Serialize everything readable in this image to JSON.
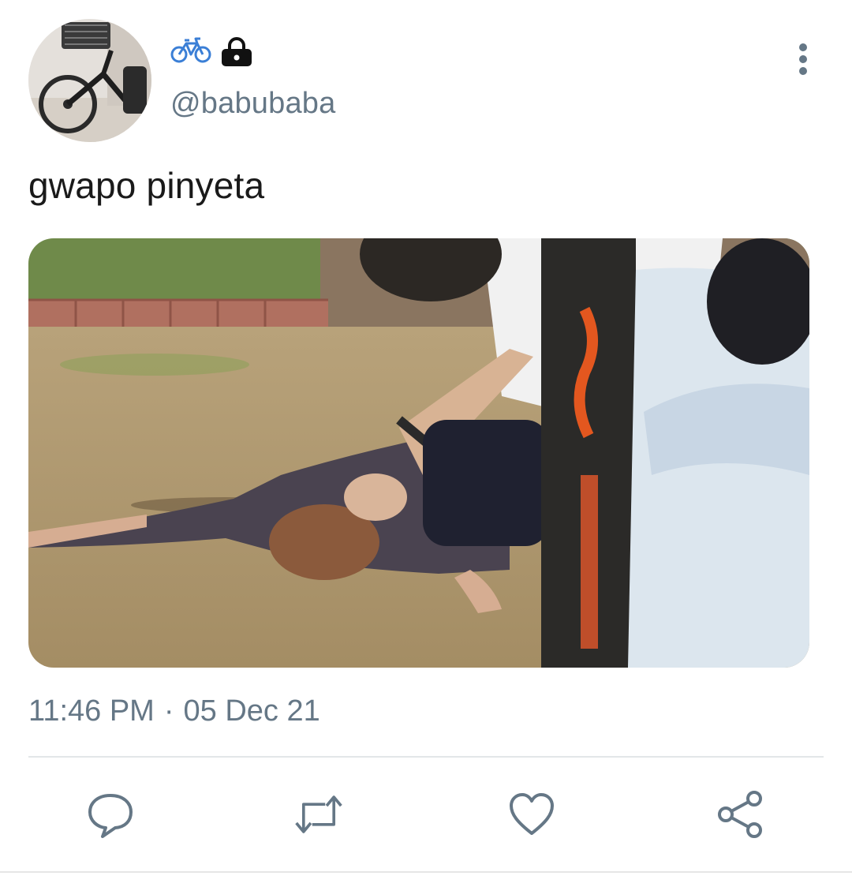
{
  "user": {
    "display_name_emoji": "🚲",
    "handle": "@babubaba",
    "protected": true
  },
  "tweet": {
    "text": "gwapo pinyeta",
    "time": "11:46 PM",
    "separator": "·",
    "date": "05 Dec 21"
  },
  "icons": {
    "name": "bicycle-emoji",
    "lock": "lock-icon",
    "more": "vertical-ellipsis-icon",
    "reply": "reply-icon",
    "retweet": "retweet-icon",
    "like": "heart-icon",
    "share": "share-icon"
  },
  "colors": {
    "text": "#1a1a1a",
    "secondary": "#657786",
    "icon": "#657786",
    "divider": "#e3e6e8"
  }
}
